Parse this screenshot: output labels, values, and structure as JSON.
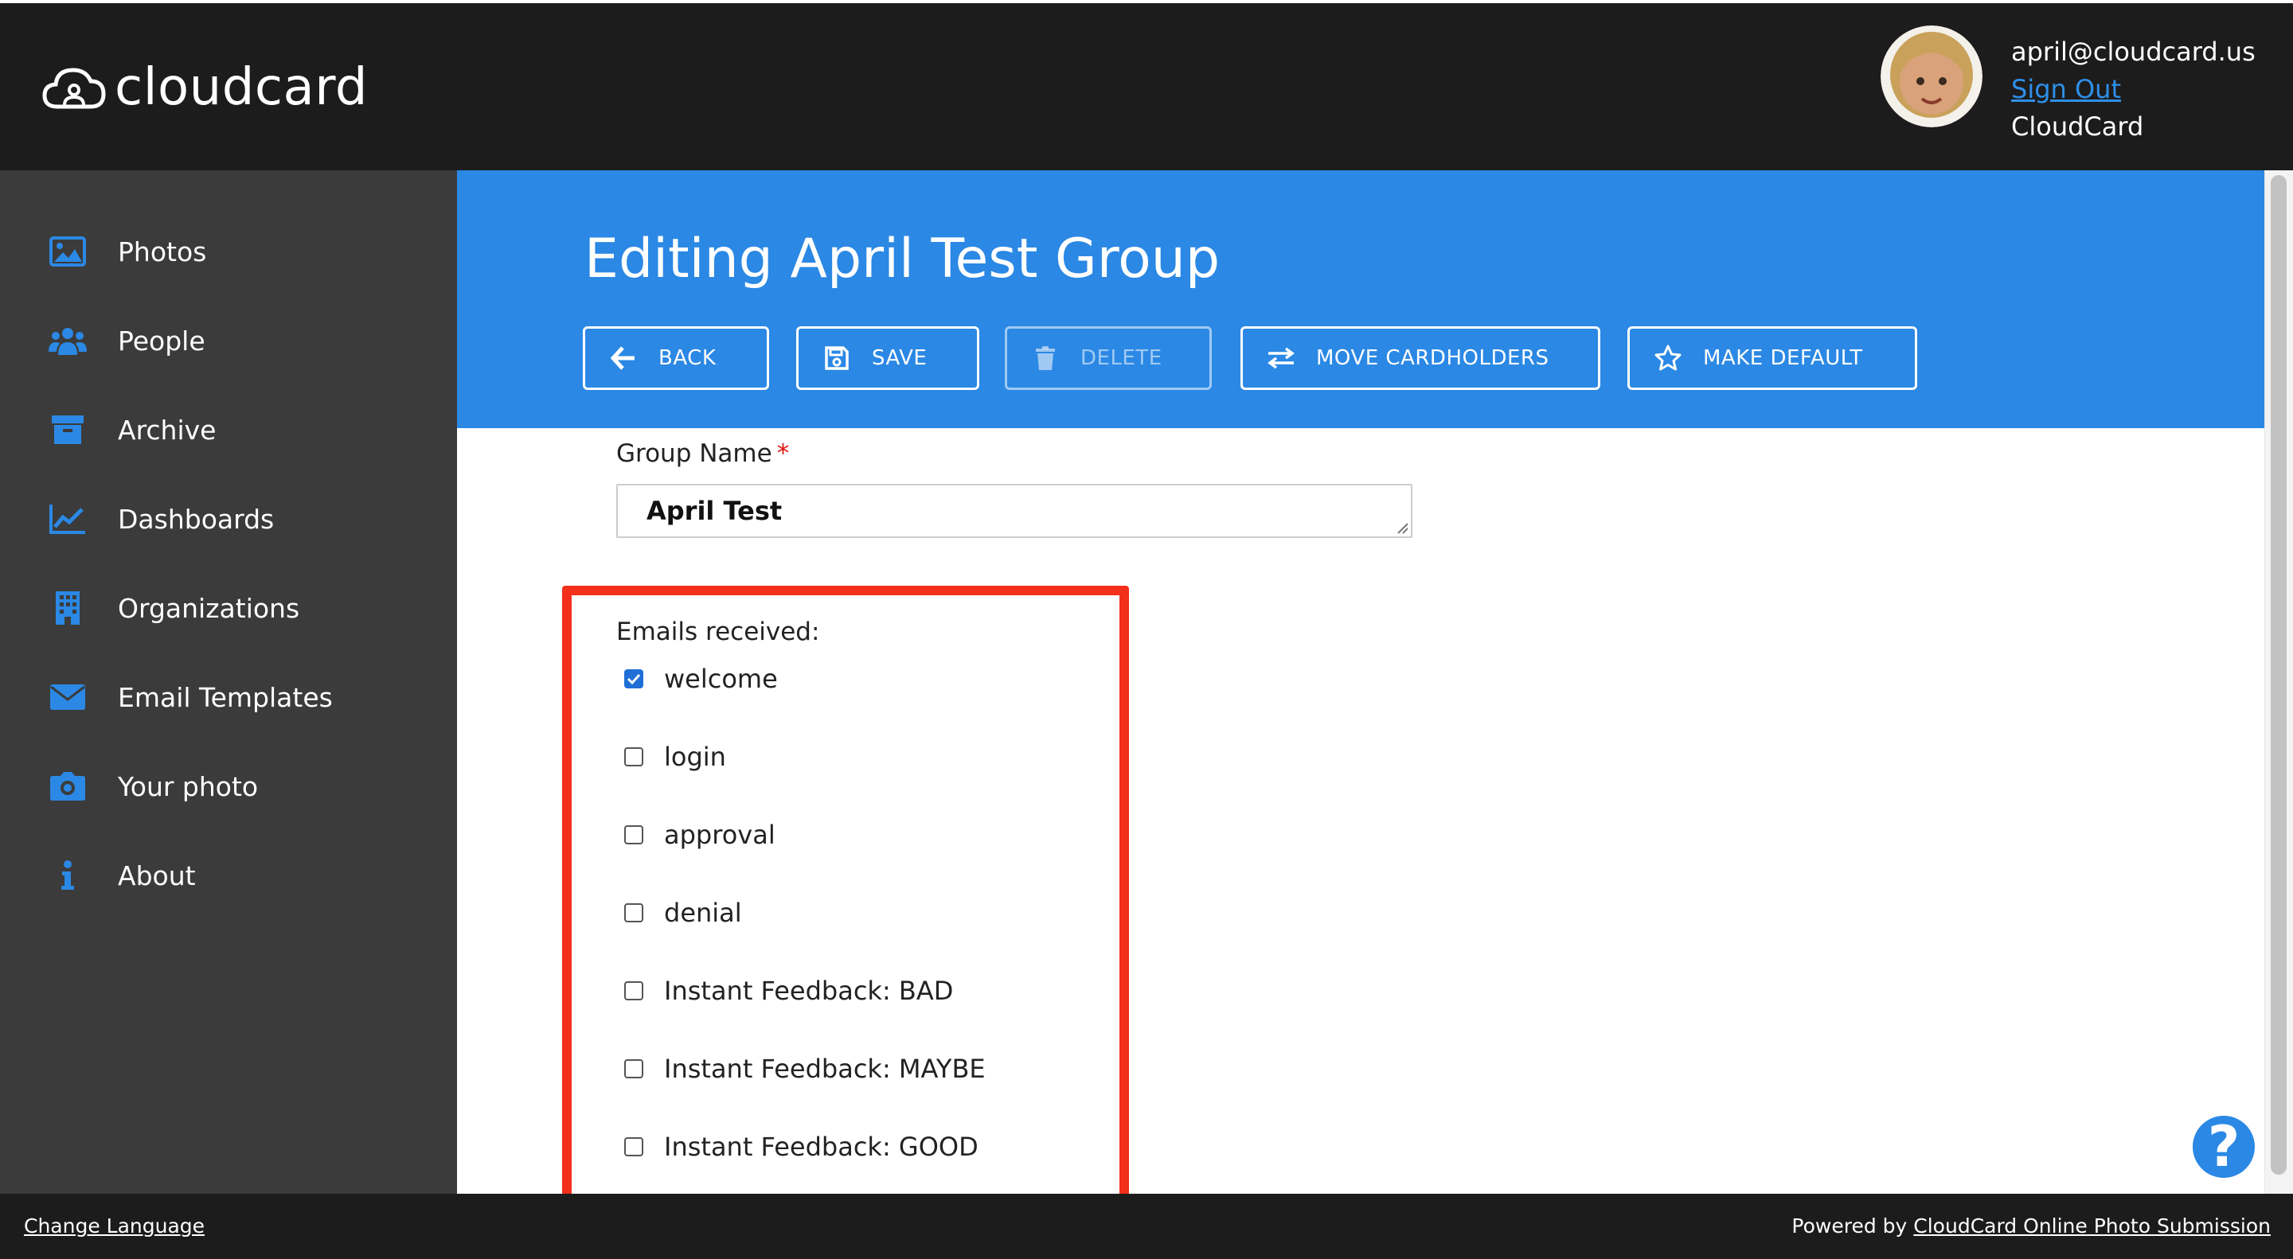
{
  "header": {
    "logo_text": "cloudcard",
    "user_email": "april@cloudcard.us",
    "sign_out": "Sign Out",
    "org_name": "CloudCard"
  },
  "sidebar": {
    "items": [
      {
        "label": "Photos",
        "icon": "photo-icon"
      },
      {
        "label": "People",
        "icon": "people-icon"
      },
      {
        "label": "Archive",
        "icon": "archive-icon"
      },
      {
        "label": "Dashboards",
        "icon": "chart-icon"
      },
      {
        "label": "Organizations",
        "icon": "building-icon"
      },
      {
        "label": "Email Templates",
        "icon": "envelope-icon"
      },
      {
        "label": "Your photo",
        "icon": "camera-icon"
      },
      {
        "label": "About",
        "icon": "info-icon"
      }
    ]
  },
  "main": {
    "title": "Editing April Test Group",
    "buttons": {
      "back": "BACK",
      "save": "SAVE",
      "delete": "DELETE",
      "move": "MOVE CARDHOLDERS",
      "default": "MAKE DEFAULT"
    },
    "group_name_label": "Group Name",
    "required_mark": "*",
    "group_name_value": "April Test",
    "emails_label": "Emails received:",
    "emails": [
      {
        "label": "welcome",
        "checked": true
      },
      {
        "label": "login",
        "checked": false
      },
      {
        "label": "approval",
        "checked": false
      },
      {
        "label": "denial",
        "checked": false
      },
      {
        "label": "Instant Feedback: BAD",
        "checked": false
      },
      {
        "label": "Instant Feedback: MAYBE",
        "checked": false
      },
      {
        "label": "Instant Feedback: GOOD",
        "checked": false
      }
    ]
  },
  "help": "?",
  "footer": {
    "change_language": "Change Language",
    "powered_by": "Powered by",
    "powered_link": "CloudCard Online Photo Submission"
  },
  "colors": {
    "header_bg": "#1c1c1c",
    "sidebar_bg": "#3b3b3b",
    "accent": "#2b88e4",
    "highlight": "#f2301b"
  }
}
